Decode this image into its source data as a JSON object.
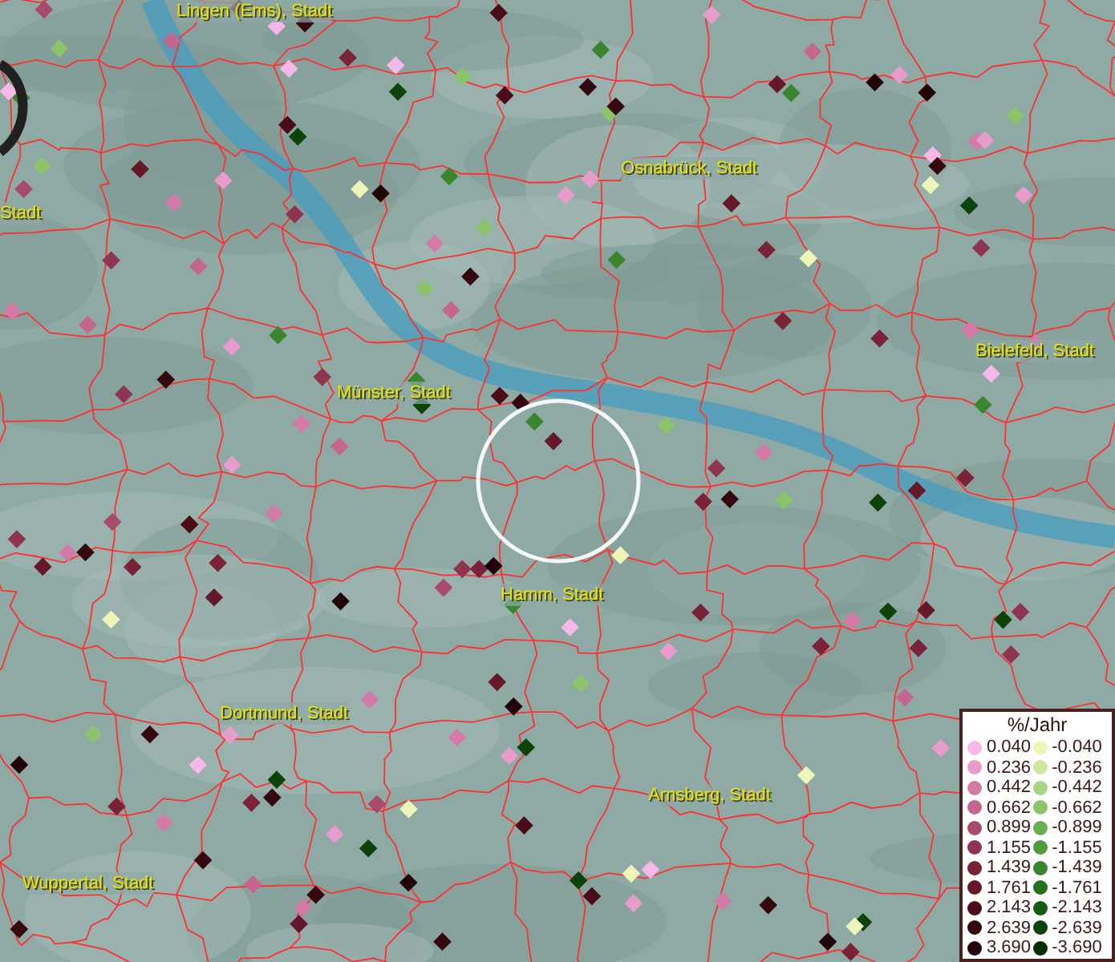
{
  "map": {
    "place_labels": [
      "Lingen (Ems), Stadt",
      "Stadt",
      "Osnabrück, Stadt",
      "Bielefeld, Stadt",
      "Münster, Stadt",
      "Hamm, Stadt",
      "Dortmund, Stadt",
      "Arnsberg, Stadt",
      "Wuppertal, Stadt"
    ]
  },
  "legend": {
    "title": "%/Jahr",
    "rows": [
      {
        "positive": {
          "label": "0.040",
          "color": "#f5b8e8"
        },
        "negative": {
          "label": "-0.040",
          "color": "#eef5b8"
        }
      },
      {
        "positive": {
          "label": "0.236",
          "color": "#e89ccb"
        },
        "negative": {
          "label": "-0.236",
          "color": "#cfe6a0"
        }
      },
      {
        "positive": {
          "label": "0.442",
          "color": "#d47aa8"
        },
        "negative": {
          "label": "-0.442",
          "color": "#a8d486"
        }
      },
      {
        "positive": {
          "label": "0.662",
          "color": "#c46690"
        },
        "negative": {
          "label": "-0.662",
          "color": "#8cc46c"
        }
      },
      {
        "positive": {
          "label": "0.899",
          "color": "#a84a6c"
        },
        "negative": {
          "label": "-0.899",
          "color": "#6aae52"
        }
      },
      {
        "positive": {
          "label": "1.155",
          "color": "#8f3550"
        },
        "negative": {
          "label": "-1.155",
          "color": "#4f9a3e"
        }
      },
      {
        "positive": {
          "label": "1.439",
          "color": "#7a2238"
        },
        "negative": {
          "label": "-1.439",
          "color": "#3a862e"
        }
      },
      {
        "positive": {
          "label": "1.761",
          "color": "#651828"
        },
        "negative": {
          "label": "-1.761",
          "color": "#24701e"
        }
      },
      {
        "positive": {
          "label": "2.143",
          "color": "#4a0d18"
        },
        "negative": {
          "label": "-2.143",
          "color": "#145a12"
        }
      },
      {
        "positive": {
          "label": "2.639",
          "color": "#350810"
        },
        "negative": {
          "label": "-2.639",
          "color": "#0b4308"
        }
      },
      {
        "positive": {
          "label": "3.690",
          "color": "#200408"
        },
        "negative": {
          "label": "-3.690",
          "color": "#062e04"
        }
      }
    ]
  }
}
